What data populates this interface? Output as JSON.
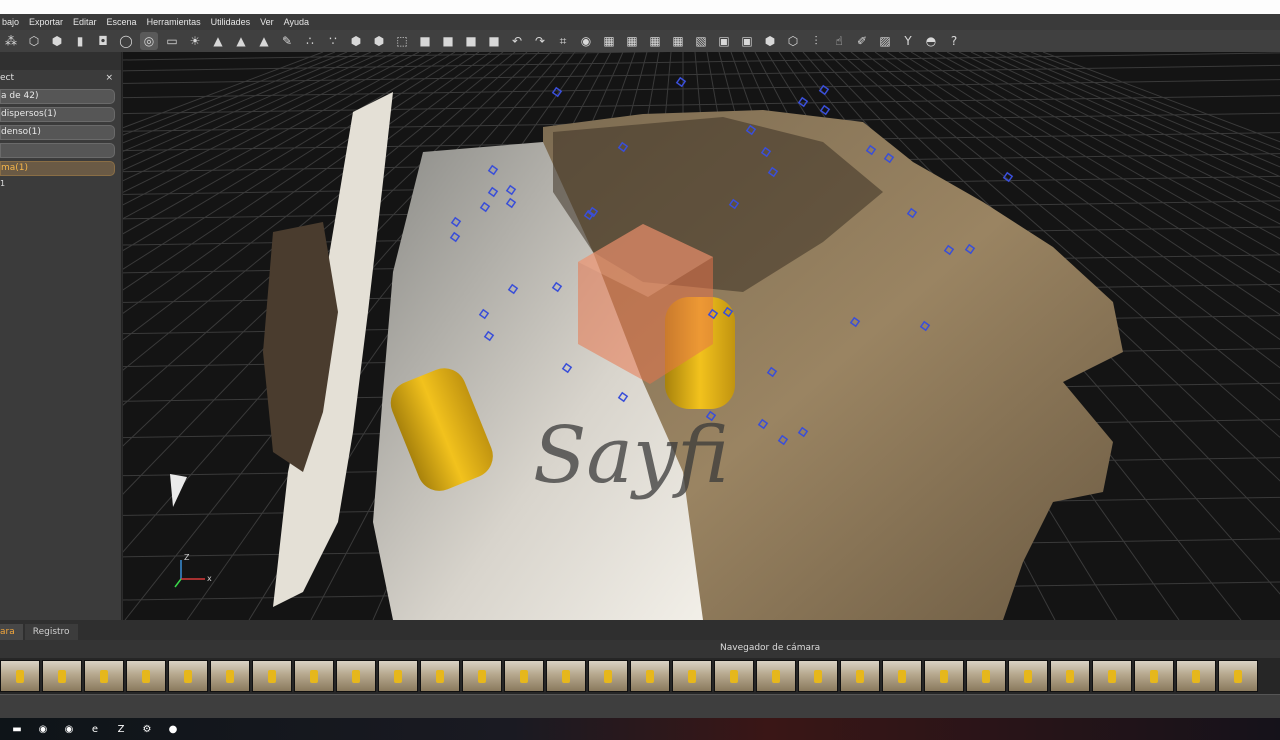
{
  "menu": [
    "bajo",
    "Exportar",
    "Editar",
    "Escena",
    "Herramientas",
    "Utilidades",
    "Ver",
    "Ayuda"
  ],
  "toolbar": {
    "icons": [
      "mesh-icon",
      "cube-icon",
      "cube-icon",
      "book-icon",
      "camera-icon",
      "rotate-icon",
      "orbit-icon",
      "ruler-icon",
      "bulb-icon",
      "mountain-icon",
      "mountain-color-icon",
      "mountain-red-icon",
      "brush-icon",
      "points-icon",
      "points-green-icon",
      "cube-green-icon",
      "cube-red-icon",
      "select-rect-icon",
      "square-icon",
      "square-icon",
      "square-icon",
      "square-icon",
      "undo-icon",
      "redo-icon",
      "crop-icon",
      "target-icon",
      "grid-icon",
      "grid-icon",
      "grid-icon",
      "grid-icon",
      "camera-grid-icon",
      "square-icon",
      "square-icon",
      "hexagon-icon",
      "cube-outline-icon",
      "ruler-vertical-icon",
      "hand-icon",
      "paint-icon",
      "stripes-icon",
      "wrench-icon",
      "mask-icon",
      "help-icon"
    ],
    "glyphs": [
      "⁂",
      "⬡",
      "⬢",
      "▮",
      "◘",
      "◯",
      "◎",
      "▭",
      "☀",
      "▲",
      "▲",
      "▲",
      "✎",
      "∴",
      "∵",
      "⬢",
      "⬢",
      "⬚",
      "■",
      "■",
      "■",
      "■",
      "↶",
      "↷",
      "⌗",
      "◉",
      "▦",
      "▦",
      "▦",
      "▦",
      "▧",
      "▣",
      "▣",
      "⬢",
      "⬡",
      "⫶",
      "☝",
      "✐",
      "▨",
      "Y",
      "◓",
      "?"
    ]
  },
  "left_panel": {
    "title": "ect",
    "close": "×",
    "items": [
      "a de 42)",
      "dispersos(1)",
      "denso(1)",
      "",
      "ma(1)"
    ],
    "sub_item": "1"
  },
  "viewport": {
    "watermark": "Sayfi",
    "axis_labels": {
      "z": "Z",
      "x": "x"
    },
    "colors": {
      "background": "#141414",
      "grid": "#3a3a3a",
      "camera_marker": "#3a4fd8",
      "selection_box": "#e87a4a"
    }
  },
  "lower_tabs": [
    "ara",
    "Registro"
  ],
  "navigator": {
    "title": "Navegador de cámara",
    "thumbnail_count": 30
  },
  "taskbar": {
    "icons": [
      "explorer-icon",
      "chrome-icon",
      "firefox-icon",
      "edge-icon",
      "filezilla-icon",
      "app-icon",
      "app2-icon"
    ],
    "glyphs": [
      "▬",
      "◉",
      "◉",
      "e",
      "Z",
      "⚙",
      "●"
    ]
  }
}
